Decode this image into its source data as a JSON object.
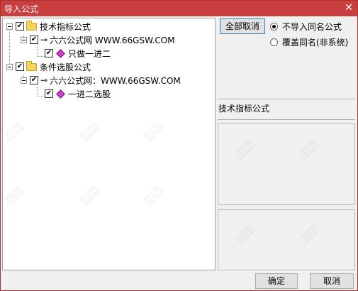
{
  "window": {
    "title": "导入公式",
    "close_icon": "close-icon"
  },
  "tree": {
    "groups": [
      {
        "label": "技术指标公式",
        "checked": true,
        "expanded": true,
        "children": [
          {
            "label": "六六公式网 WWW.66GSW.COM",
            "checked": true,
            "children": [
              {
                "label": "只做一进二",
                "checked": true
              }
            ]
          }
        ]
      },
      {
        "label": "条件选股公式",
        "checked": true,
        "expanded": true,
        "children": [
          {
            "label": "六六公式网：WWW.66GSW.COM",
            "checked": true,
            "children": [
              {
                "label": "一进二选股",
                "checked": true
              }
            ]
          }
        ]
      }
    ]
  },
  "buttons": {
    "cancel_all": "全部取消",
    "ok": "确定",
    "cancel": "取消"
  },
  "options": {
    "no_import_same_name": "不导入同名公式",
    "overwrite_same_name": "覆盖同名(非系统)",
    "selected": "no_import_same_name"
  },
  "detail": {
    "category_label": "技术指标公式"
  }
}
